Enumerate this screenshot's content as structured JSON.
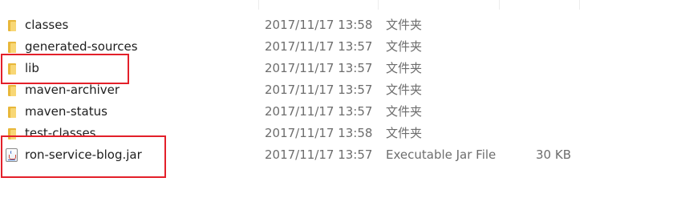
{
  "files": [
    {
      "name": "classes",
      "date": "2017/11/17 13:58",
      "type": "文件夹",
      "size": "",
      "icon": "folder-icon"
    },
    {
      "name": "generated-sources",
      "date": "2017/11/17 13:57",
      "type": "文件夹",
      "size": "",
      "icon": "folder-icon"
    },
    {
      "name": "lib",
      "date": "2017/11/17 13:57",
      "type": "文件夹",
      "size": "",
      "icon": "folder-icon"
    },
    {
      "name": "maven-archiver",
      "date": "2017/11/17 13:57",
      "type": "文件夹",
      "size": "",
      "icon": "folder-icon"
    },
    {
      "name": "maven-status",
      "date": "2017/11/17 13:57",
      "type": "文件夹",
      "size": "",
      "icon": "folder-icon"
    },
    {
      "name": "test-classes",
      "date": "2017/11/17 13:58",
      "type": "文件夹",
      "size": "",
      "icon": "folder-icon"
    },
    {
      "name": "ron-service-blog.jar",
      "date": "2017/11/17 13:57",
      "type": "Executable Jar File",
      "size": "30 KB",
      "icon": "jar-file-icon"
    }
  ],
  "colors": {
    "highlight": "#e3202a",
    "folder": "#f8d775",
    "secondary_text": "#6d6d6d"
  }
}
